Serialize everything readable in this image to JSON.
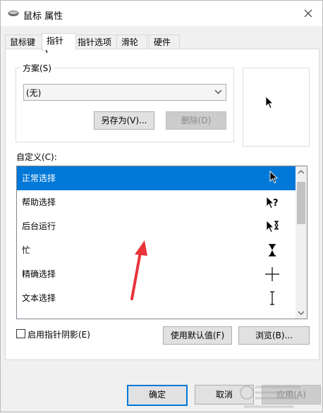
{
  "window": {
    "title": "鼠标 属性",
    "close_icon": "close-icon"
  },
  "tabs": [
    {
      "label": "鼠标键",
      "active": false
    },
    {
      "label": "指针",
      "active": true
    },
    {
      "label": "指针选项",
      "active": false
    },
    {
      "label": "滑轮",
      "active": false
    },
    {
      "label": "硬件",
      "active": false
    }
  ],
  "scheme": {
    "legend": "方案(S)",
    "selected": "(无)",
    "save_as_label": "另存为(V)...",
    "delete_label": "删除(D)"
  },
  "customize": {
    "label": "自定义(C):",
    "items": [
      {
        "label": "正常选择",
        "icon": "arrow-pointer-icon",
        "selected": true
      },
      {
        "label": "帮助选择",
        "icon": "help-pointer-icon",
        "selected": false
      },
      {
        "label": "后台运行",
        "icon": "working-in-background-icon",
        "selected": false
      },
      {
        "label": "忙",
        "icon": "hourglass-icon",
        "selected": false
      },
      {
        "label": "精确选择",
        "icon": "crosshair-icon",
        "selected": false
      },
      {
        "label": "文本选择",
        "icon": "text-ibeam-icon",
        "selected": false
      }
    ]
  },
  "shadow_checkbox": {
    "label": "启用指针阴影(E)",
    "checked": false
  },
  "buttons": {
    "use_default": "使用默认值(F)",
    "browse": "浏览(B)...",
    "ok": "确定",
    "cancel": "取消",
    "apply": "应用(A)"
  },
  "colors": {
    "accent": "#0078d7",
    "annotation": "#e8343a"
  }
}
